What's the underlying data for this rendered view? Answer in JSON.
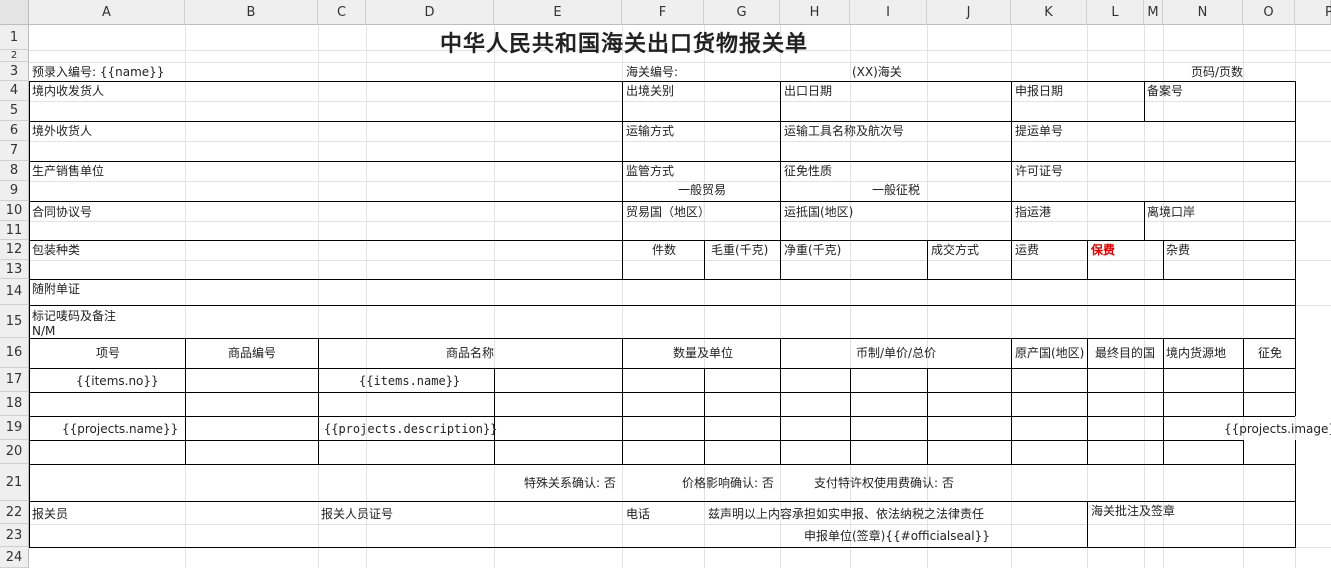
{
  "columns": [
    "A",
    "B",
    "C",
    "D",
    "E",
    "F",
    "G",
    "H",
    "I",
    "J",
    "K",
    "L",
    "M",
    "N",
    "O",
    "P"
  ],
  "rows": [
    "1",
    "2",
    "3",
    "4",
    "5",
    "6",
    "7",
    "8",
    "9",
    "10",
    "11",
    "12",
    "13",
    "14",
    "15",
    "16",
    "17",
    "18",
    "19",
    "20",
    "21",
    "22",
    "23",
    "24"
  ],
  "title": "中华人民共和国海关出口货物报关单",
  "r3": {
    "pre_no": "预录入编号: {{name}}",
    "customs_no": "海关编号:",
    "customs_name": "(XX)海关",
    "page": "页码/页数"
  },
  "r4": {
    "consignor": "境内收发货人",
    "exit_customs": "出境关别",
    "exit_date": "出口日期",
    "decl_date": "申报日期",
    "record_no": "备案号"
  },
  "r6": {
    "consignee": "境外收货人",
    "transport_mode": "运输方式",
    "vehicle": "运输工具名称及航次号",
    "bill_no": "提运单号"
  },
  "r8": {
    "producer": "生产销售单位",
    "supervision": "监管方式",
    "tax_nature": "征免性质",
    "license": "许可证号"
  },
  "r9": {
    "supervision_val": "一般贸易",
    "tax_val": "一般征税"
  },
  "r10": {
    "contract": "合同协议号",
    "trade_country": "贸易国（地区）",
    "dest_country": "运抵国(地区)",
    "port": "指运港",
    "exit_port": "离境口岸"
  },
  "r12": {
    "package": "包装种类",
    "pieces": "件数",
    "gross": "毛重(千克)",
    "net": "净重(千克)",
    "deal": "成交方式",
    "freight": "运费",
    "insurance": "保费",
    "misc": "杂费"
  },
  "r14": {
    "documents": "随附单证"
  },
  "r15": {
    "marks": "标记唛码及备注",
    "marks_val": "N/M"
  },
  "r16": {
    "item_no": "项号",
    "goods_code": "商品编号",
    "goods_name": "商品名称",
    "qty_unit": "数量及单位",
    "currency": "币制/单价/总价",
    "origin": "原产国(地区)",
    "final_dest": "最终目的国",
    "source": "境内货源地",
    "levy": "征免"
  },
  "r17": {
    "items_no": "{{items.no}}",
    "items_name": "{{items.name}}"
  },
  "r19": {
    "proj_name": "{{projects.name}}",
    "proj_desc": "{{projects.description}}",
    "proj_image": "{{projects.image}}"
  },
  "r21": {
    "special": "特殊关系确认:  否",
    "price": "价格影响确认:  否",
    "royalty": "支付特许权使用费确认:  否"
  },
  "r22": {
    "declarant": "报关员",
    "declarant_id": "报关人员证号",
    "phone": "电话",
    "statement": "兹声明以上内容承担如实申报、依法纳税之法律责任",
    "approval": "海关批注及签章"
  },
  "r23": {
    "unit_sign": "申报单位(签章){{#officialseal}}"
  }
}
